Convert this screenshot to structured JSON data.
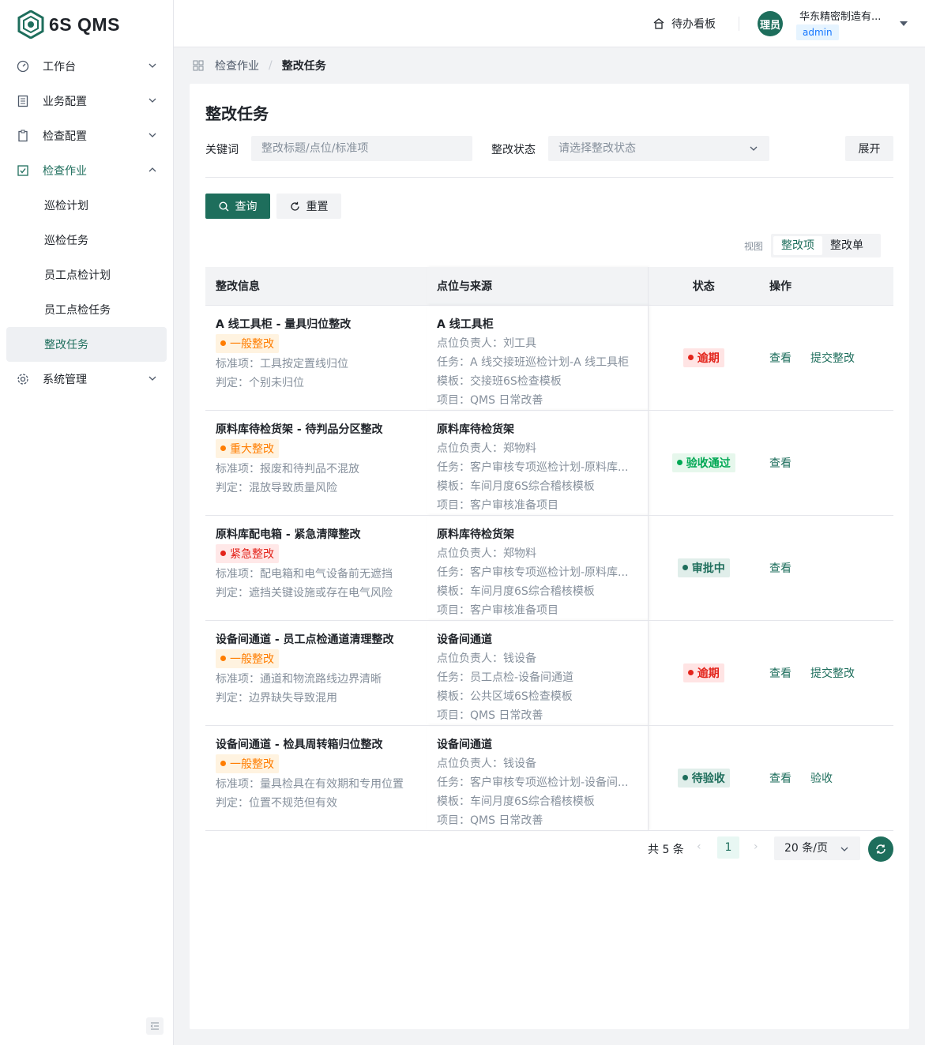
{
  "app": {
    "logo": "6S QMS"
  },
  "sidebar": {
    "items": [
      {
        "label": "工作台",
        "icon": "dashboard-icon"
      },
      {
        "label": "业务配置",
        "icon": "document-icon"
      },
      {
        "label": "检查配置",
        "icon": "clipboard-icon"
      },
      {
        "label": "检查作业",
        "icon": "checkbox-icon"
      },
      {
        "label": "巡检计划"
      },
      {
        "label": "巡检任务"
      },
      {
        "label": "员工点检计划"
      },
      {
        "label": "员工点检任务"
      },
      {
        "label": "整改任务"
      },
      {
        "label": "系统管理",
        "icon": "gear-icon"
      }
    ]
  },
  "header": {
    "todo_label": "待办看板",
    "avatar_text": "理员",
    "company": "华东精密制造有...",
    "role": "admin"
  },
  "breadcrumb": {
    "parent": "检查作业",
    "current": "整改任务"
  },
  "page": {
    "title": "整改任务"
  },
  "filters": {
    "keyword_label": "关键词",
    "keyword_placeholder": "整改标题/点位/标准项",
    "status_label": "整改状态",
    "status_placeholder": "请选择整改状态",
    "expand_label": "展开",
    "query_label": "查询",
    "reset_label": "重置"
  },
  "view": {
    "label": "视图",
    "options": [
      "整改项",
      "整改单"
    ],
    "selected": "整改项"
  },
  "table": {
    "headers": [
      "整改信息",
      "点位与来源",
      "状态",
      "操作"
    ],
    "rows": [
      {
        "title": "A 线工具柜 - 量具归位整改",
        "level": "一般整改",
        "level_type": "normal",
        "standard": "标准项：工具按定置线归位",
        "verdict": "判定：个别未归位",
        "point": "A 线工具柜",
        "owner": "点位负责人：刘工具",
        "task": "任务：A 线交接班巡检计划-A 线工具柜",
        "template": "模板：交接班6S检查模板",
        "project": "项目：QMS 日常改善",
        "status": "逾期",
        "status_type": "overdue",
        "ops": [
          "查看",
          "提交整改"
        ]
      },
      {
        "title": "原料库待检货架 - 待判品分区整改",
        "level": "重大整改",
        "level_type": "major",
        "standard": "标准项：报废和待判品不混放",
        "verdict": "判定：混放导致质量风险",
        "point": "原料库待检货架",
        "owner": "点位负责人：郑物料",
        "task": "任务：客户审核专项巡检计划-原料库...",
        "template": "模板：车间月度6S综合稽核模板",
        "project": "项目：客户审核准备项目",
        "status": "验收通过",
        "status_type": "pass",
        "ops": [
          "查看"
        ]
      },
      {
        "title": "原料库配电箱 - 紧急清障整改",
        "level": "紧急整改",
        "level_type": "urgent",
        "standard": "标准项：配电箱和电气设备前无遮挡",
        "verdict": "判定：遮挡关键设施或存在电气风险",
        "point": "原料库待检货架",
        "owner": "点位负责人：郑物料",
        "task": "任务：客户审核专项巡检计划-原料库...",
        "template": "模板：车间月度6S综合稽核模板",
        "project": "项目：客户审核准备项目",
        "status": "审批中",
        "status_type": "appr",
        "ops": [
          "查看"
        ]
      },
      {
        "title": "设备间通道 - 员工点检通道清理整改",
        "level": "一般整改",
        "level_type": "normal",
        "standard": "标准项：通道和物流路线边界清晰",
        "verdict": "判定：边界缺失导致混用",
        "point": "设备间通道",
        "owner": "点位负责人：钱设备",
        "task": "任务：员工点检-设备间通道",
        "template": "模板：公共区域6S检查模板",
        "project": "项目：QMS 日常改善",
        "status": "逾期",
        "status_type": "overdue",
        "ops": [
          "查看",
          "提交整改"
        ]
      },
      {
        "title": "设备间通道 - 检具周转箱归位整改",
        "level": "一般整改",
        "level_type": "normal",
        "standard": "标准项：量具检具在有效期和专用位置",
        "verdict": "判定：位置不规范但有效",
        "point": "设备间通道",
        "owner": "点位负责人：钱设备",
        "task": "任务：客户审核专项巡检计划-设备间...",
        "template": "模板：车间月度6S综合稽核模板",
        "project": "项目：QMS 日常改善",
        "status": "待验收",
        "status_type": "acc",
        "ops": [
          "查看",
          "验收"
        ]
      }
    ]
  },
  "pager": {
    "total": "共 5 条",
    "page": "1",
    "size": "20 条/页"
  },
  "colors": {
    "primary": "#1e6e5c",
    "overdue": "#e3241b",
    "pass": "#00a854",
    "warn": "#ff7d00"
  }
}
